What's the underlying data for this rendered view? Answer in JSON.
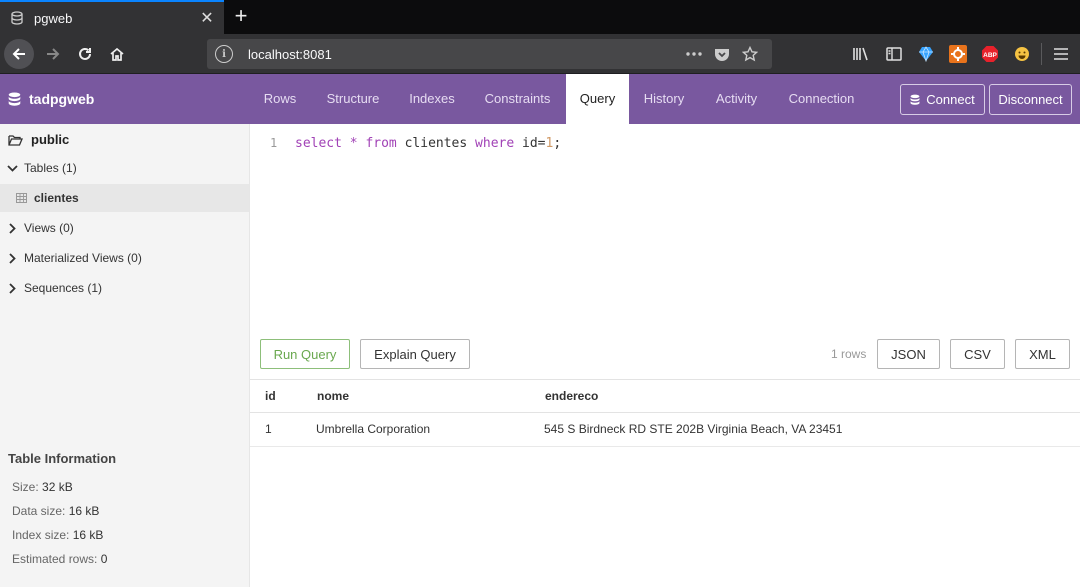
{
  "browser": {
    "tab_title": "pgweb",
    "url": "localhost:8081"
  },
  "app": {
    "brand": "tadpgweb",
    "tabs": [
      "Rows",
      "Structure",
      "Indexes",
      "Constraints",
      "Query",
      "History",
      "Activity",
      "Connection"
    ],
    "active_tab": "Query",
    "connect_label": "Connect",
    "disconnect_label": "Disconnect",
    "accent_color": "#79589f"
  },
  "sidebar": {
    "schema": "public",
    "tables_label": "Tables (1)",
    "tables": [
      "clientes"
    ],
    "views_label": "Views (0)",
    "materialized_views_label": "Materialized Views (0)",
    "sequences_label": "Sequences (1)"
  },
  "table_info": {
    "title": "Table Information",
    "rows": [
      {
        "label": "Size:",
        "value": "32 kB"
      },
      {
        "label": "Data size:",
        "value": "16 kB"
      },
      {
        "label": "Index size:",
        "value": "16 kB"
      },
      {
        "label": "Estimated rows:",
        "value": "0"
      }
    ]
  },
  "editor": {
    "line_number": "1",
    "query": "select * from clientes where id=1;"
  },
  "actions": {
    "run_query": "Run Query",
    "explain_query": "Explain Query",
    "row_count": "1 rows",
    "json": "JSON",
    "csv": "CSV",
    "xml": "XML"
  },
  "results": {
    "columns": [
      "id",
      "nome",
      "endereco"
    ],
    "rows": [
      [
        "1",
        "Umbrella Corporation",
        "545 S Birdneck RD STE 202B Virginia Beach, VA 23451"
      ]
    ]
  }
}
